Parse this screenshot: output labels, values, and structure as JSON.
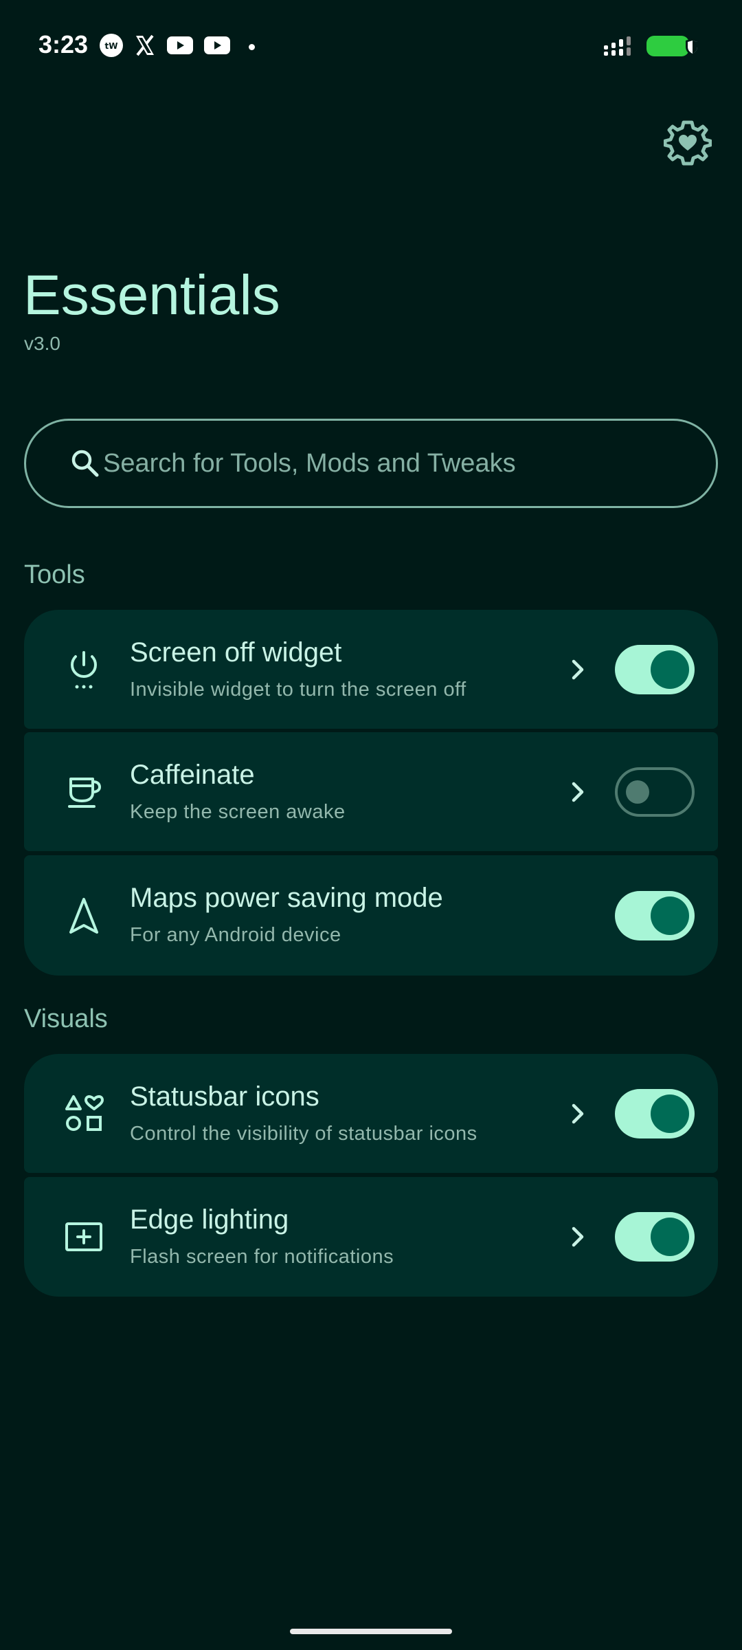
{
  "status_bar": {
    "time": "3:23",
    "notification_icons": [
      "tin-whs-icon",
      "x-icon",
      "youtube-icon",
      "youtube-icon"
    ],
    "battery_color": "#2ecc40"
  },
  "app": {
    "title": "Essentials",
    "version": "v3.0"
  },
  "search": {
    "placeholder": "Search for Tools, Mods and Tweaks",
    "value": ""
  },
  "sections": [
    {
      "header": "Tools",
      "items": [
        {
          "title": "Screen off widget",
          "subtitle": "Invisible widget to turn the screen off",
          "icon": "power-icon",
          "has_chevron": true,
          "enabled": true
        },
        {
          "title": "Caffeinate",
          "subtitle": "Keep the screen awake",
          "icon": "coffee-cup-icon",
          "has_chevron": true,
          "enabled": false
        },
        {
          "title": "Maps power saving mode",
          "subtitle": "For any Android device",
          "icon": "navigation-icon",
          "has_chevron": false,
          "enabled": true
        }
      ]
    },
    {
      "header": "Visuals",
      "items": [
        {
          "title": "Statusbar icons",
          "subtitle": "Control the visibility of statusbar icons",
          "icon": "shapes-icon",
          "has_chevron": true,
          "enabled": true
        },
        {
          "title": "Edge lighting",
          "subtitle": "Flash screen for notifications",
          "icon": "screen-plus-icon",
          "has_chevron": true,
          "enabled": true
        }
      ]
    }
  ],
  "colors": {
    "background": "#001a17",
    "card": "#002e29",
    "accent": "#a7f5d6",
    "toggle_knob": "#006b55"
  }
}
